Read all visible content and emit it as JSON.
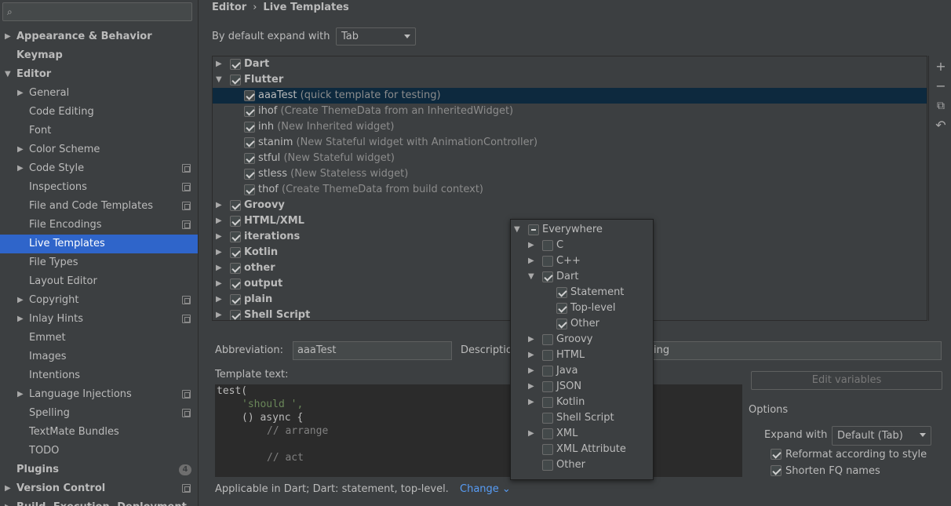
{
  "breadcrumb": {
    "parent": "Editor",
    "separator": "›",
    "current": "Live Templates"
  },
  "sidebar": {
    "search_placeholder": "",
    "items": [
      {
        "label": "Appearance & Behavior",
        "bold": true,
        "arrow": "▶",
        "level": 0
      },
      {
        "label": "Keymap",
        "bold": true,
        "level": 0
      },
      {
        "label": "Editor",
        "bold": true,
        "arrow": "▼",
        "level": 0
      },
      {
        "label": "General",
        "arrow": "▶",
        "level": 1
      },
      {
        "label": "Code Editing",
        "level": 1
      },
      {
        "label": "Font",
        "level": 1
      },
      {
        "label": "Color Scheme",
        "arrow": "▶",
        "level": 1
      },
      {
        "label": "Code Style",
        "arrow": "▶",
        "level": 1,
        "project": true
      },
      {
        "label": "Inspections",
        "level": 1,
        "project": true
      },
      {
        "label": "File and Code Templates",
        "level": 1,
        "project": true
      },
      {
        "label": "File Encodings",
        "level": 1,
        "project": true
      },
      {
        "label": "Live Templates",
        "level": 1,
        "selected": true
      },
      {
        "label": "File Types",
        "level": 1
      },
      {
        "label": "Layout Editor",
        "level": 1
      },
      {
        "label": "Copyright",
        "arrow": "▶",
        "level": 1,
        "project": true
      },
      {
        "label": "Inlay Hints",
        "arrow": "▶",
        "level": 1,
        "project": true
      },
      {
        "label": "Emmet",
        "level": 1
      },
      {
        "label": "Images",
        "level": 1
      },
      {
        "label": "Intentions",
        "level": 1
      },
      {
        "label": "Language Injections",
        "arrow": "▶",
        "level": 1,
        "project": true
      },
      {
        "label": "Spelling",
        "level": 1,
        "project": true
      },
      {
        "label": "TextMate Bundles",
        "level": 1
      },
      {
        "label": "TODO",
        "level": 1
      },
      {
        "label": "Plugins",
        "bold": true,
        "level": 0,
        "badge": "4"
      },
      {
        "label": "Version Control",
        "bold": true,
        "arrow": "▶",
        "level": 0,
        "project": true
      },
      {
        "label": "Build, Execution, Deployment",
        "bold": true,
        "arrow": "▶",
        "level": 0
      }
    ]
  },
  "expand": {
    "label": "By default expand with",
    "value": "Tab"
  },
  "templates": [
    {
      "name": "Dart",
      "group": true,
      "arrow": "▶"
    },
    {
      "name": "Flutter",
      "group": true,
      "arrow": "▼"
    },
    {
      "name": "aaaTest",
      "desc": "(quick template for testing)",
      "selected": true
    },
    {
      "name": "ihof",
      "desc": "(Create ThemeData from an InheritedWidget)"
    },
    {
      "name": "inh",
      "desc": "(New Inherited widget)"
    },
    {
      "name": "stanim",
      "desc": "(New Stateful widget with AnimationController)"
    },
    {
      "name": "stful",
      "desc": "(New Stateful widget)"
    },
    {
      "name": "stless",
      "desc": "(New Stateless widget)"
    },
    {
      "name": "thof",
      "desc": "(Create ThemeData from build context)"
    },
    {
      "name": "Groovy",
      "group": true,
      "arrow": "▶"
    },
    {
      "name": "HTML/XML",
      "group": true,
      "arrow": "▶"
    },
    {
      "name": "iterations",
      "group": true,
      "arrow": "▶"
    },
    {
      "name": "Kotlin",
      "group": true,
      "arrow": "▶"
    },
    {
      "name": "other",
      "group": true,
      "arrow": "▶"
    },
    {
      "name": "output",
      "group": true,
      "arrow": "▶"
    },
    {
      "name": "plain",
      "group": true,
      "arrow": "▶"
    },
    {
      "name": "Shell Script",
      "group": true,
      "arrow": "▶"
    }
  ],
  "toolbar": {
    "add": "+",
    "remove": "−",
    "copy": "⧉",
    "revert": "↶"
  },
  "details": {
    "abbreviation_label": "Abbreviation:",
    "abbreviation_value": "aaaTest",
    "description_label": "Descriptio",
    "description_value": "ing",
    "template_text_label": "Template text:",
    "code_lines": [
      {
        "text": "test(",
        "indent": 0,
        "kind": "plain"
      },
      {
        "text": "'should ',",
        "indent": 4,
        "kind": "str"
      },
      {
        "text": "() async {",
        "indent": 4,
        "kind": "plain"
      },
      {
        "text": "// arrange",
        "indent": 8,
        "kind": "cmt"
      },
      {
        "text": "",
        "indent": 0,
        "kind": "plain"
      },
      {
        "text": "// act",
        "indent": 8,
        "kind": "cmt"
      }
    ],
    "applicable_text": "Applicable in Dart; Dart: statement, top-level.",
    "change_label": "Change",
    "change_caret": "⌄",
    "edit_variables": "Edit variables",
    "options_label": "Options",
    "expand_with_label": "Expand with",
    "expand_with_value": "Default (Tab)",
    "reformat_label": "Reformat according to style",
    "shorten_label": "Shorten FQ names"
  },
  "contexts": [
    {
      "label": "Everywhere",
      "level": 0,
      "arrow": "▼",
      "state": "dash"
    },
    {
      "label": "C",
      "level": 1,
      "arrow": "▶",
      "state": "off"
    },
    {
      "label": "C++",
      "level": 1,
      "arrow": "▶",
      "state": "off"
    },
    {
      "label": "Dart",
      "level": 1,
      "arrow": "▼",
      "state": "on"
    },
    {
      "label": "Statement",
      "level": 2,
      "state": "on"
    },
    {
      "label": "Top-level",
      "level": 2,
      "state": "on"
    },
    {
      "label": "Other",
      "level": 2,
      "state": "on"
    },
    {
      "label": "Groovy",
      "level": 1,
      "arrow": "▶",
      "state": "off"
    },
    {
      "label": "HTML",
      "level": 1,
      "arrow": "▶",
      "state": "off"
    },
    {
      "label": "Java",
      "level": 1,
      "arrow": "▶",
      "state": "off"
    },
    {
      "label": "JSON",
      "level": 1,
      "arrow": "▶",
      "state": "off"
    },
    {
      "label": "Kotlin",
      "level": 1,
      "arrow": "▶",
      "state": "off"
    },
    {
      "label": "Shell Script",
      "level": 1,
      "state": "off"
    },
    {
      "label": "XML",
      "level": 1,
      "arrow": "▶",
      "state": "off"
    },
    {
      "label": "XML Attribute",
      "level": 1,
      "state": "off"
    },
    {
      "label": "Other",
      "level": 1,
      "state": "off"
    }
  ]
}
